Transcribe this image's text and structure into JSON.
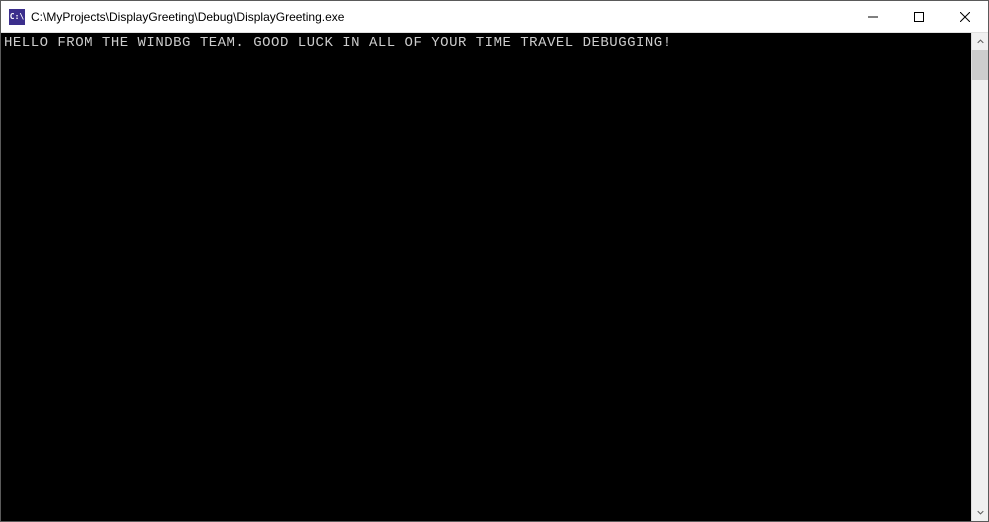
{
  "window": {
    "title": "C:\\MyProjects\\DisplayGreeting\\Debug\\DisplayGreeting.exe",
    "icon_label": "C:\\"
  },
  "console": {
    "output": "HELLO FROM THE WINDBG TEAM. GOOD LUCK IN ALL OF YOUR TIME TRAVEL DEBUGGING!"
  }
}
